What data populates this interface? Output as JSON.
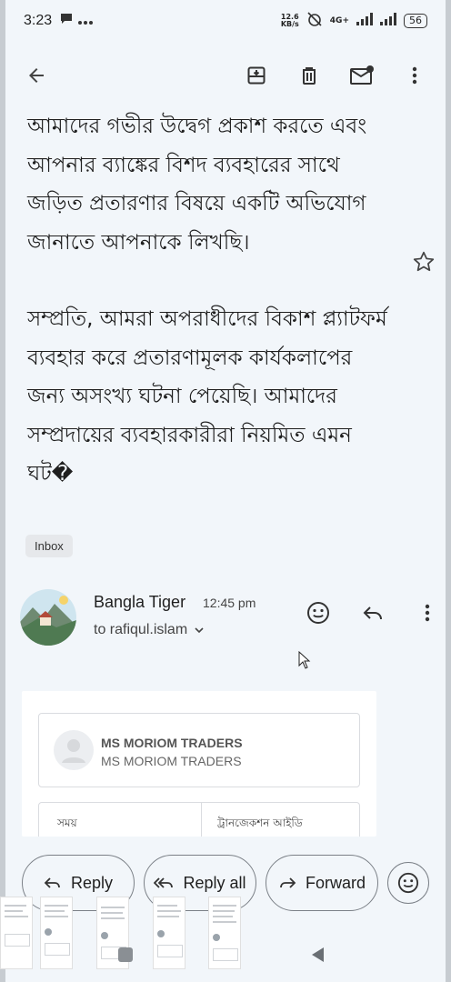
{
  "status_bar": {
    "time": "3:23",
    "net_speed_value": "12.6",
    "net_speed_unit": "KB/s",
    "network": "4G+",
    "battery": "56"
  },
  "app_bar": {
    "back_icon": "arrow-left-icon",
    "actions": [
      "archive-icon",
      "trash-icon",
      "mark-unread-icon",
      "more-vert-icon"
    ]
  },
  "email": {
    "body_paragraph_1": "আমাদের গভীর উদ্বেগ প্রকাশ করতে এবং আপনার ব্যাঙ্কের বিশদ ব্যবহারের সাথে জড়িত প্রতারণার বিষয়ে একটি অভিযোগ জানাতে আপনাকে লিখছি।",
    "body_paragraph_2": "সম্প্রতি, আমরা অপরাধীদের বিকাশ প্ল্যাটফর্ম ব্যবহার করে প্রতারণামূলক কার্যকলাপের জন্য অসংখ্য ঘটনা পেয়েছি। আমাদের সম্প্রদায়ের ব্যবহারকারীরা নিয়মিত এমন ঘট�",
    "label": "Inbox"
  },
  "message": {
    "sender_name": "Bangla Tiger",
    "time": "12:45 pm",
    "recipient": "to rafiqul.islam"
  },
  "attachment": {
    "merchant_name": "MS MORIOM TRADERS",
    "merchant_sub": "MS MORIOM TRADERS",
    "col_time": "সময়",
    "col_txn_id": "ট্রানজেকশন আইডি"
  },
  "actions": {
    "reply": "Reply",
    "reply_all": "Reply all",
    "forward": "Forward"
  },
  "colors": {
    "background": "#f2f6fa",
    "text": "#1f1f1f",
    "chip": "#e6e8eb"
  }
}
